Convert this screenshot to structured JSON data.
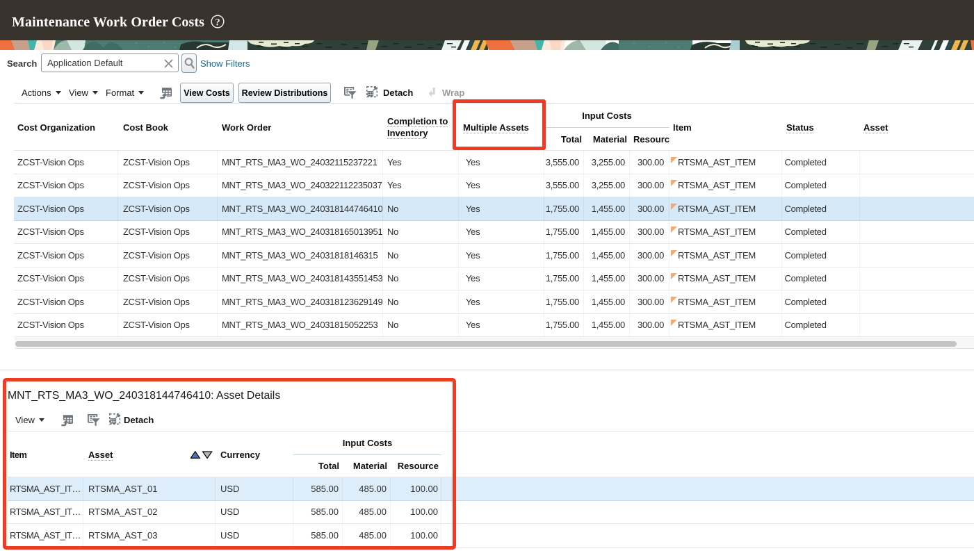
{
  "header": {
    "title": "Maintenance Work Order Costs"
  },
  "search": {
    "label": "Search",
    "value": "Application Default",
    "show_filters": "Show Filters"
  },
  "toolbar": {
    "actions": "Actions",
    "view": "View",
    "format": "Format",
    "view_costs": "View Costs",
    "review_distributions": "Review Distributions",
    "detach": "Detach",
    "wrap": "Wrap"
  },
  "main_table": {
    "columns": {
      "cost_organization": "Cost Organization",
      "cost_book": "Cost Book",
      "work_order": "Work Order",
      "completion_to_inventory": "Completion to Inventory",
      "multiple_assets": "Multiple Assets",
      "input_costs": "Input Costs",
      "total": "Total",
      "material": "Material",
      "resource": "Resource",
      "item": "Item",
      "status": "Status",
      "asset": "Asset"
    },
    "rows": [
      {
        "cost_org": "ZCST-Vision Ops",
        "cost_book": "ZCST-Vision Ops",
        "work_order": "MNT_RTS_MA3_WO_24032115237221",
        "completion": "Yes",
        "multiple": "Yes",
        "total": "3,555.00",
        "material": "3,255.00",
        "resource": "300.00",
        "item": "RTSMA_AST_ITEM",
        "status": "Completed",
        "asset": "",
        "selected": false
      },
      {
        "cost_org": "ZCST-Vision Ops",
        "cost_book": "ZCST-Vision Ops",
        "work_order": "MNT_RTS_MA3_WO_240322112235037",
        "completion": "Yes",
        "multiple": "Yes",
        "total": "3,555.00",
        "material": "3,255.00",
        "resource": "300.00",
        "item": "RTSMA_AST_ITEM",
        "status": "Completed",
        "asset": "",
        "selected": false
      },
      {
        "cost_org": "ZCST-Vision Ops",
        "cost_book": "ZCST-Vision Ops",
        "work_order": "MNT_RTS_MA3_WO_240318144746410",
        "completion": "No",
        "multiple": "Yes",
        "total": "1,755.00",
        "material": "1,455.00",
        "resource": "300.00",
        "item": "RTSMA_AST_ITEM",
        "status": "Completed",
        "asset": "",
        "selected": true
      },
      {
        "cost_org": "ZCST-Vision Ops",
        "cost_book": "ZCST-Vision Ops",
        "work_order": "MNT_RTS_MA3_WO_240318165013951",
        "completion": "No",
        "multiple": "Yes",
        "total": "1,755.00",
        "material": "1,455.00",
        "resource": "300.00",
        "item": "RTSMA_AST_ITEM",
        "status": "Completed",
        "asset": "",
        "selected": false
      },
      {
        "cost_org": "ZCST-Vision Ops",
        "cost_book": "ZCST-Vision Ops",
        "work_order": "MNT_RTS_MA3_WO_24031818146315",
        "completion": "No",
        "multiple": "Yes",
        "total": "1,755.00",
        "material": "1,455.00",
        "resource": "300.00",
        "item": "RTSMA_AST_ITEM",
        "status": "Completed",
        "asset": "",
        "selected": false
      },
      {
        "cost_org": "ZCST-Vision Ops",
        "cost_book": "ZCST-Vision Ops",
        "work_order": "MNT_RTS_MA3_WO_240318143551453",
        "completion": "No",
        "multiple": "Yes",
        "total": "1,755.00",
        "material": "1,455.00",
        "resource": "300.00",
        "item": "RTSMA_AST_ITEM",
        "status": "Completed",
        "asset": "",
        "selected": false
      },
      {
        "cost_org": "ZCST-Vision Ops",
        "cost_book": "ZCST-Vision Ops",
        "work_order": "MNT_RTS_MA3_WO_240318123629149",
        "completion": "No",
        "multiple": "Yes",
        "total": "1,755.00",
        "material": "1,455.00",
        "resource": "300.00",
        "item": "RTSMA_AST_ITEM",
        "status": "Completed",
        "asset": "",
        "selected": false
      },
      {
        "cost_org": "ZCST-Vision Ops",
        "cost_book": "ZCST-Vision Ops",
        "work_order": "MNT_RTS_MA3_WO_24031815052253",
        "completion": "No",
        "multiple": "Yes",
        "total": "1,755.00",
        "material": "1,455.00",
        "resource": "300.00",
        "item": "RTSMA_AST_ITEM",
        "status": "Completed",
        "asset": "",
        "selected": false
      }
    ]
  },
  "detail": {
    "title": "MNT_RTS_MA3_WO_240318144746410: Asset Details",
    "toolbar": {
      "view": "View",
      "detach": "Detach"
    },
    "columns": {
      "item": "Item",
      "asset": "Asset",
      "currency": "Currency",
      "input_costs": "Input Costs",
      "total": "Total",
      "material": "Material",
      "resource": "Resource"
    },
    "rows": [
      {
        "item": "RTSMA_AST_ITEM",
        "asset": "RTSMA_AST_01",
        "currency": "USD",
        "total": "585.00",
        "material": "485.00",
        "resource": "100.00",
        "selected": true
      },
      {
        "item": "RTSMA_AST_ITEM",
        "asset": "RTSMA_AST_02",
        "currency": "USD",
        "total": "585.00",
        "material": "485.00",
        "resource": "100.00",
        "selected": false
      },
      {
        "item": "RTSMA_AST_ITEM",
        "asset": "RTSMA_AST_03",
        "currency": "USD",
        "total": "585.00",
        "material": "485.00",
        "resource": "100.00",
        "selected": false
      }
    ]
  },
  "colors": {
    "titlebar": "#38322c",
    "selected_row": "#d6e9f8",
    "annotation": "#ee3c22",
    "link": "#0c6cb0"
  }
}
